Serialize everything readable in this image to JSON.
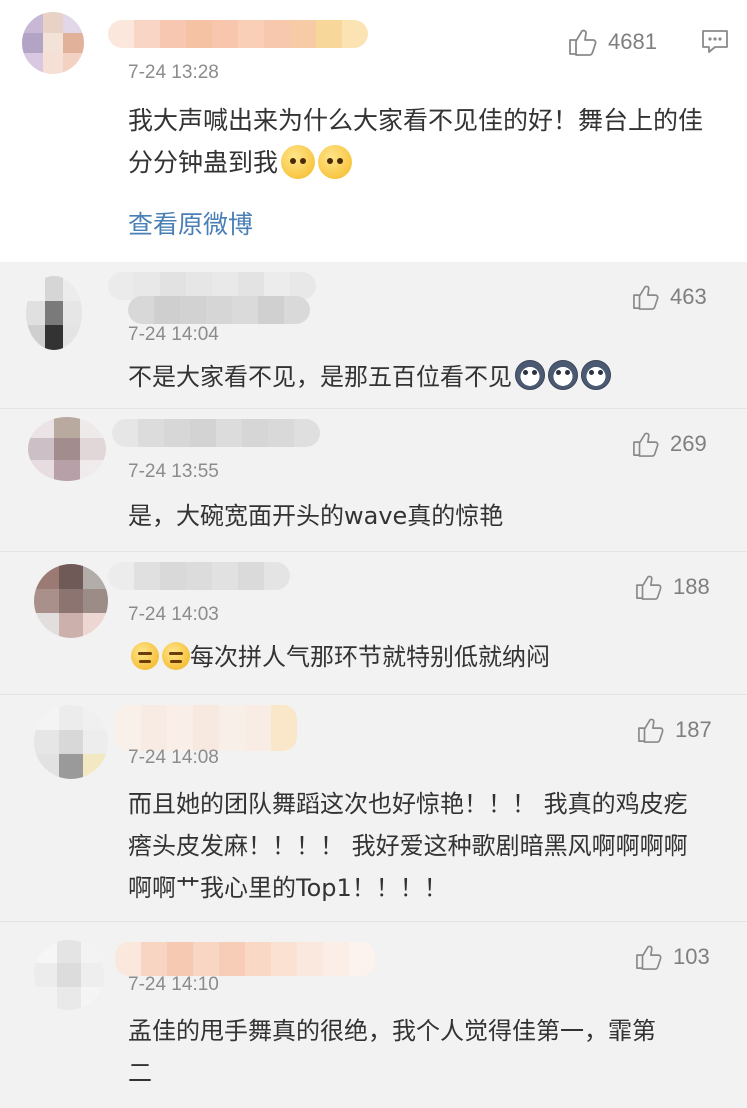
{
  "main_comment": {
    "time": "7-24 13:28",
    "likes": "4681",
    "text": "我大声喊出来为什么大家看不见佳的好！舞台上的佳分分钟蛊到我",
    "emojis": [
      "worried-face",
      "worried-face"
    ],
    "view_original": "查看原微博"
  },
  "replies": [
    {
      "time": "7-24 14:04",
      "likes": "463",
      "text": "不是大家看不见，是那五百位看不见",
      "emojis": [
        "husky-face",
        "husky-face",
        "husky-face"
      ]
    },
    {
      "time": "7-24 13:55",
      "likes": "269",
      "text": "是，大碗宽面开头的wave真的惊艳"
    },
    {
      "time": "7-24 14:03",
      "likes": "188",
      "text": "每次拼人气那环节就特别低就纳闷",
      "emojis_before": [
        "smirk-face",
        "smirk-face"
      ]
    },
    {
      "time": "7-24 14:08",
      "likes": "187",
      "text": "而且她的团队舞蹈这次也好惊艳！！！ 我真的鸡皮疙瘩头皮发麻！！！！ 我好爱这种歌剧暗黑风啊啊啊啊啊啊艹我心里的Top1！！！！"
    },
    {
      "time": "7-24 14:10",
      "likes": "103",
      "text": "孟佳的甩手舞真的很绝，我个人觉得佳第一，霏第二"
    }
  ],
  "icons": {
    "like": "thumbs-up-icon",
    "comment": "comment-bubble-icon"
  },
  "colors": {
    "link": "#4a7fb6",
    "meta_text": "#8c8c8c",
    "background": "#f2f2f2"
  }
}
